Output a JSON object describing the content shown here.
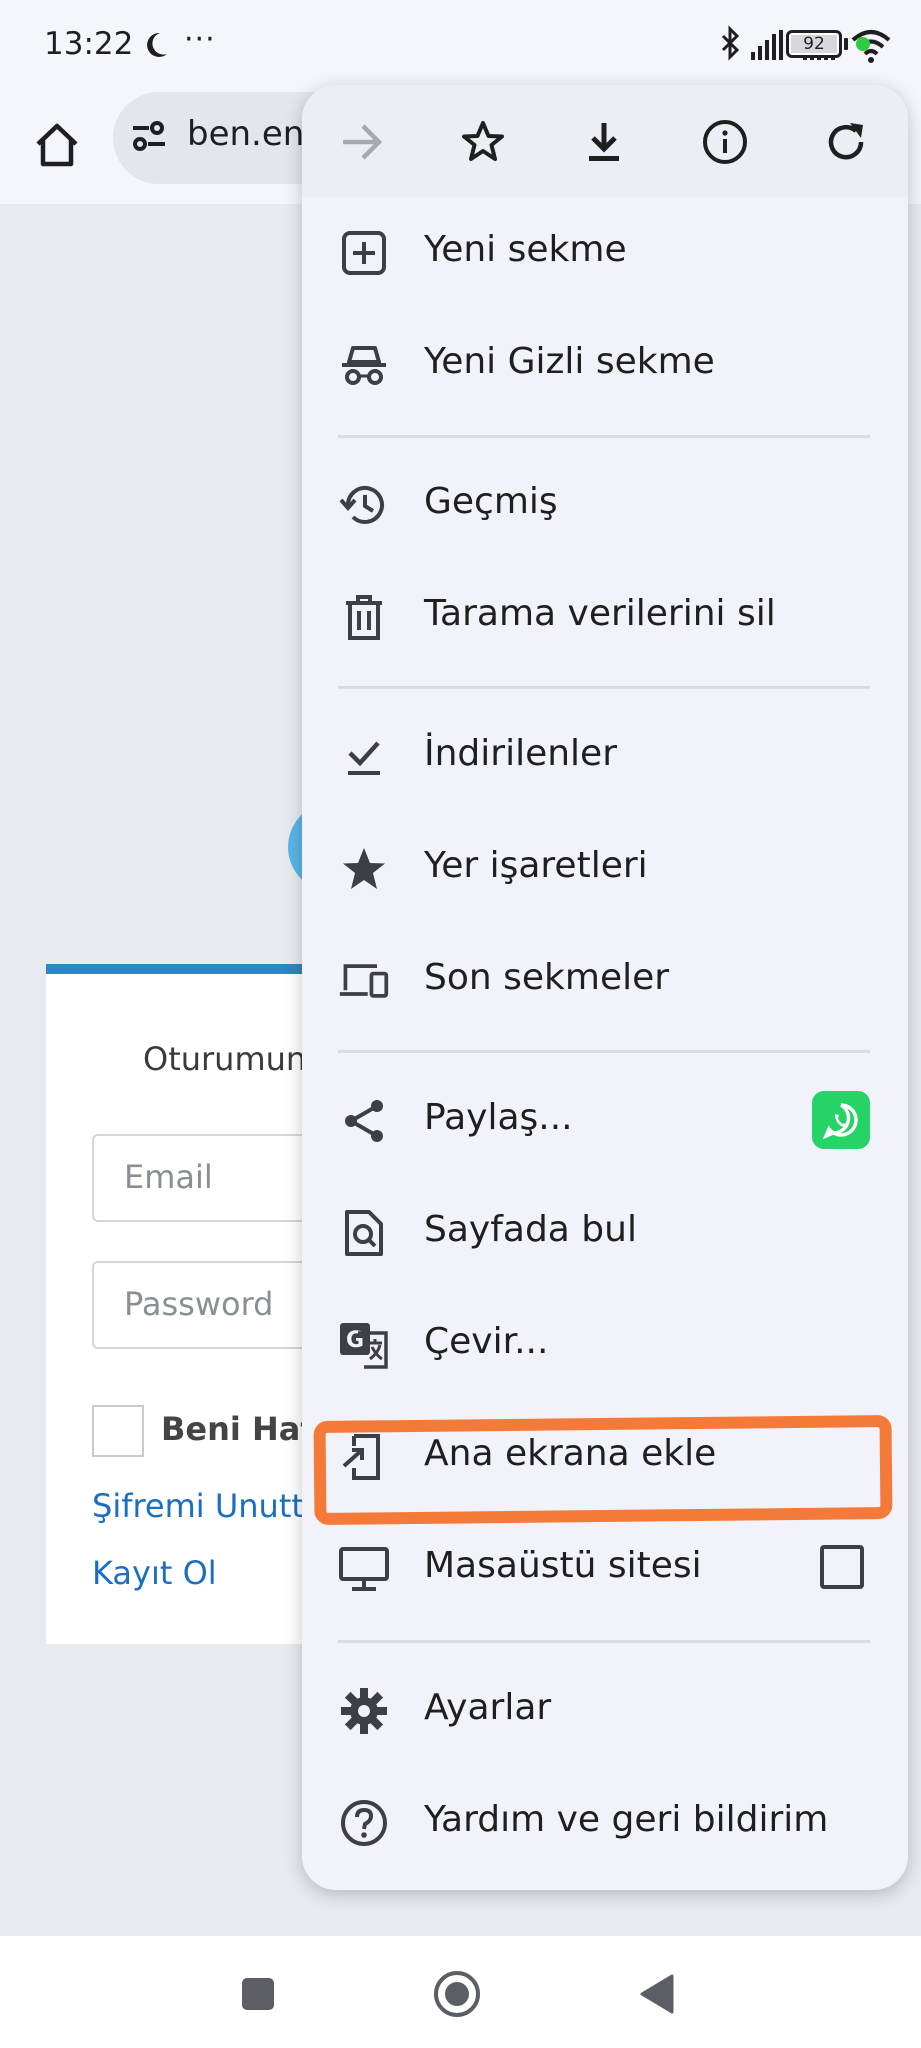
{
  "status_bar": {
    "time": "13:22",
    "dots": "···",
    "battery": "92"
  },
  "toolbar": {
    "url": "ben.en"
  },
  "page": {
    "login_title": "Oturumun",
    "email_placeholder": "Email",
    "password_placeholder": "Password",
    "remember_label": "Beni Hat",
    "forgot_link": "Şifremi Unutt",
    "register_link": "Kayıt Ol"
  },
  "menu": {
    "top_icons": [
      "forward-icon",
      "star-icon",
      "download-icon",
      "info-icon",
      "refresh-icon"
    ],
    "items": [
      {
        "label": "Yeni sekme",
        "icon": "new-tab-icon"
      },
      {
        "label": "Yeni Gizli sekme",
        "icon": "incognito-icon"
      },
      {
        "label": "Geçmiş",
        "icon": "history-icon"
      },
      {
        "label": "Tarama verilerini sil",
        "icon": "trash-icon"
      },
      {
        "label": "İndirilenler",
        "icon": "downloads-check-icon"
      },
      {
        "label": "Yer işaretleri",
        "icon": "star-filled-icon"
      },
      {
        "label": "Son sekmeler",
        "icon": "devices-icon"
      },
      {
        "label": "Paylaş...",
        "icon": "share-icon"
      },
      {
        "label": "Sayfada bul",
        "icon": "find-in-page-icon"
      },
      {
        "label": "Çevir...",
        "icon": "translate-icon"
      },
      {
        "label": "Ana ekrana ekle",
        "icon": "add-to-home-icon"
      },
      {
        "label": "Masaüstü sitesi",
        "icon": "desktop-icon"
      },
      {
        "label": "Ayarlar",
        "icon": "settings-icon"
      },
      {
        "label": "Yardım ve geri bildirim",
        "icon": "help-icon"
      }
    ],
    "desktop_site_checked": false
  },
  "colors": {
    "highlight": "#f47a3a",
    "link": "#1c6fc0",
    "card_accent": "#2f86c0",
    "whatsapp": "#25d366"
  }
}
